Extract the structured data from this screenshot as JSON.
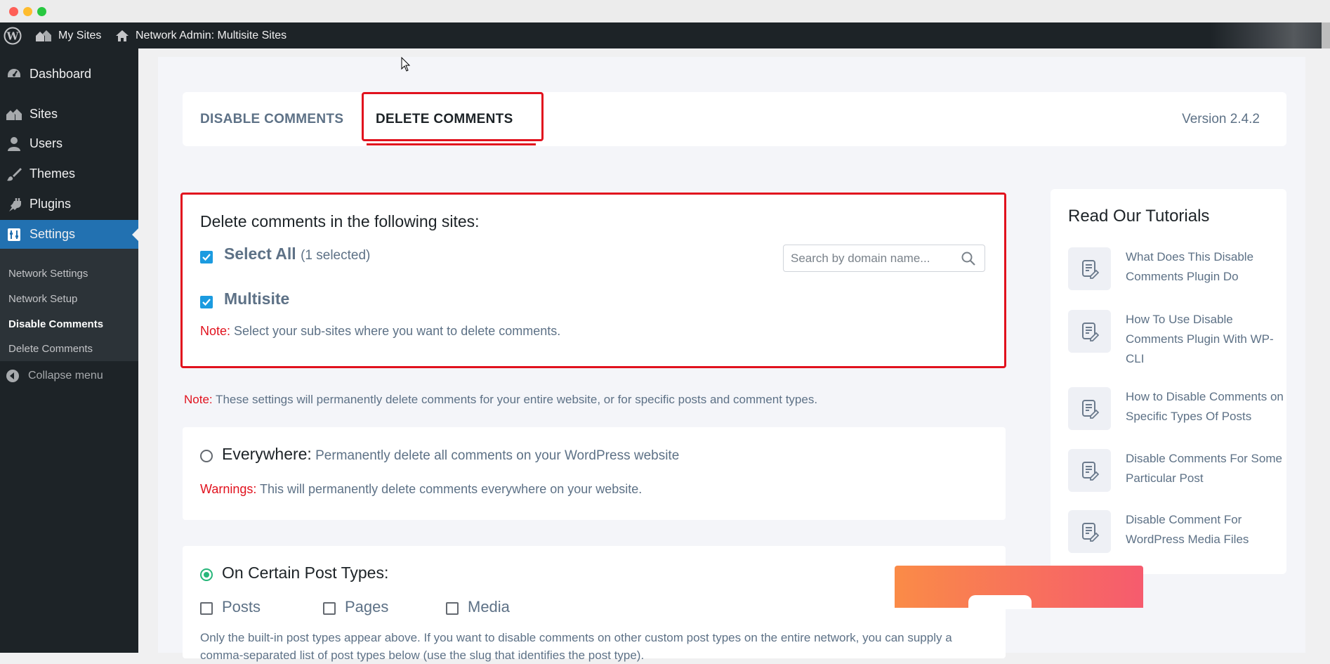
{
  "adminbar": {
    "my_sites": "My Sites",
    "network_admin": "Network Admin: Multisite Sites"
  },
  "sidebar": {
    "items": [
      {
        "label": "Dashboard",
        "icon": "dashboard-icon"
      },
      {
        "label": "Sites",
        "icon": "sites-icon"
      },
      {
        "label": "Users",
        "icon": "users-icon"
      },
      {
        "label": "Themes",
        "icon": "brush-icon"
      },
      {
        "label": "Plugins",
        "icon": "plugin-icon"
      },
      {
        "label": "Settings",
        "icon": "settings-icon",
        "active": true
      }
    ],
    "submenu": [
      "Network Settings",
      "Network Setup",
      "Disable Comments",
      "Delete Comments"
    ],
    "current_submenu": "Disable Comments",
    "collapse": "Collapse menu"
  },
  "tabs": {
    "disable": "DISABLE COMMENTS",
    "delete": "DELETE COMMENTS",
    "version": "Version 2.4.2"
  },
  "sites": {
    "heading": "Delete comments in the following sites:",
    "select_all": "Select All",
    "selected_count": "(1 selected)",
    "search_placeholder": "Search by domain name...",
    "site_name": "Multisite",
    "note_label": "Note:",
    "note_text": " Select your sub-sites where you want to delete comments."
  },
  "global_note": {
    "label": "Note:",
    "text": " These settings will permanently delete comments for your entire website, or for specific posts and comment types."
  },
  "everywhere": {
    "title": "Everywhere:",
    "desc": " Permanently delete all comments on your WordPress website",
    "warn_label": "Warnings:",
    "warn_text": " This will permanently delete comments everywhere on your website."
  },
  "post_types": {
    "title": "On Certain Post Types:",
    "options": [
      "Posts",
      "Pages",
      "Media"
    ],
    "help": "Only the built-in post types appear above. If you want to disable comments on other custom post types on the entire network, you can supply a comma-separated list of post types below (use the slug that identifies the post type)."
  },
  "tutorials": {
    "heading": "Read Our Tutorials",
    "items": [
      "What Does This Disable Comments Plugin Do",
      "How To Use Disable Comments Plugin With WP-CLI",
      "How to Disable Comments on Specific Types Of Posts",
      "Disable Comments For Some Particular Post",
      "Disable Comment For WordPress Media Files"
    ]
  },
  "colors": {
    "accent_red": "#e1121e",
    "wp_blue": "#2271b1",
    "checkbox_blue": "#1b9be0",
    "radio_green": "#27b67a",
    "admin_dark": "#1d2327"
  }
}
